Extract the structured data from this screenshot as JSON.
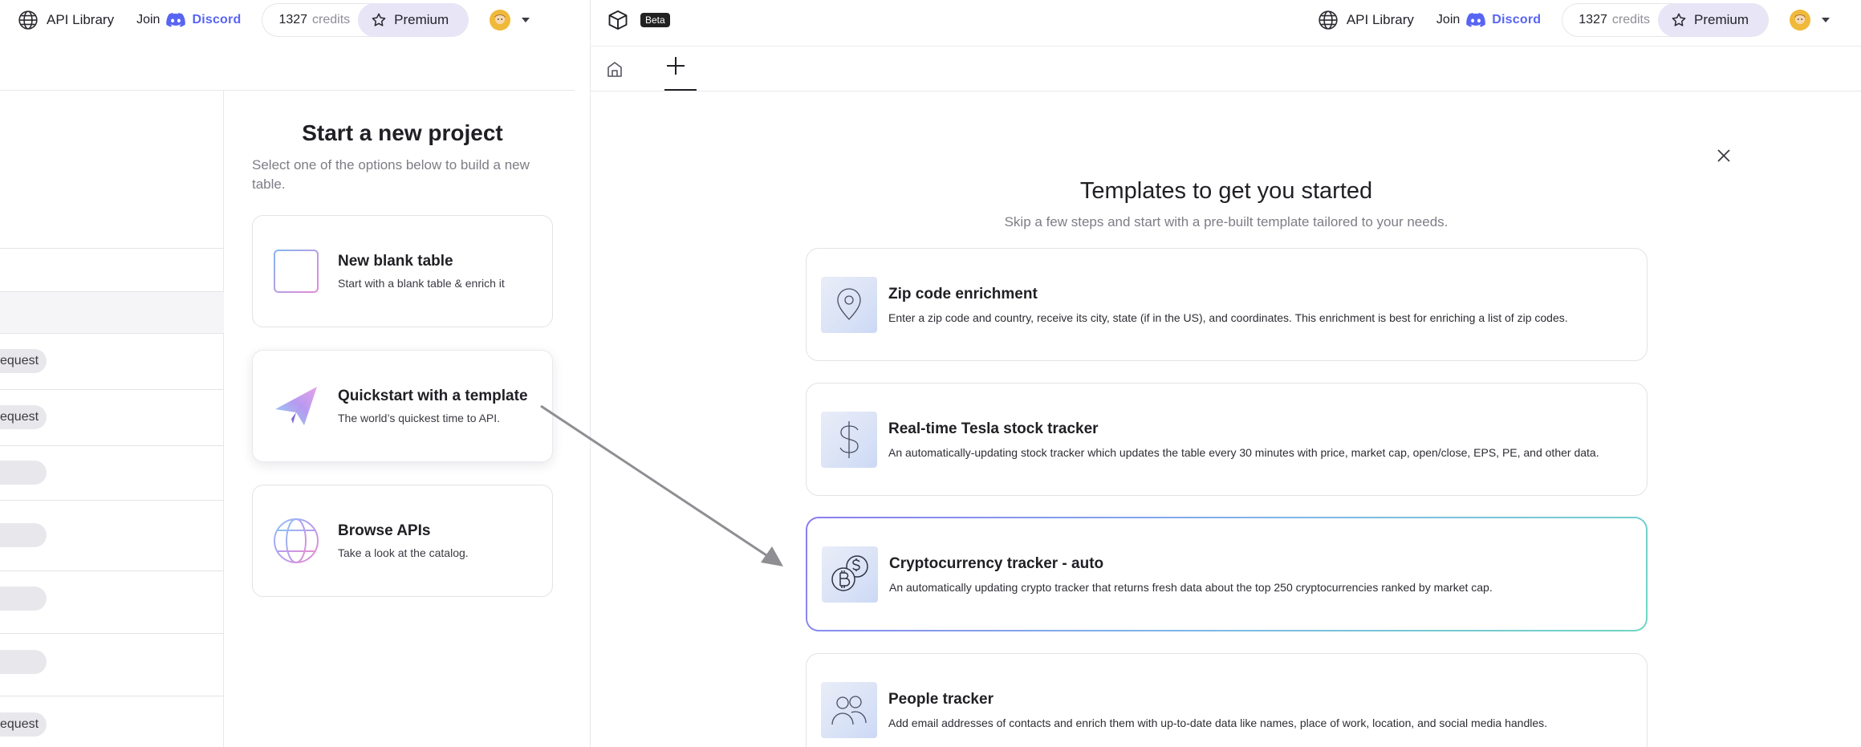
{
  "header": {
    "api_library": "API Library",
    "join": "Join",
    "discord": "Discord",
    "credits_number": "1327",
    "credits_word": "credits",
    "premium": "Premium",
    "beta": "Beta"
  },
  "ghost_table": {
    "chips": [
      "equest",
      "equest",
      "",
      "",
      "",
      "",
      "equest"
    ]
  },
  "new_project": {
    "title": "Start a new project",
    "subtitle": "Select one of the options below to build a new table.",
    "options": [
      {
        "title": "New blank table",
        "desc": "Start with a blank table & enrich it"
      },
      {
        "title": "Quickstart with a template",
        "desc": "The world’s quickest time to API."
      },
      {
        "title": "Browse APIs",
        "desc": "Take a look at the catalog."
      }
    ]
  },
  "templates": {
    "title": "Templates to get you started",
    "subtitle": "Skip a few steps and start with a pre-built template tailored to your needs.",
    "items": [
      {
        "title": "Zip code enrichment",
        "desc": "Enter a zip code and country, receive its city, state (if in the US), and coordinates. This enrichment is best for enriching a list of zip codes.",
        "icon": "map-pin-icon"
      },
      {
        "title": "Real-time Tesla stock tracker",
        "desc": "An automatically-updating stock tracker which updates the table every 30 minutes with price, market cap, open/close, EPS, PE, and other data.",
        "icon": "dollar-icon"
      },
      {
        "title": "Cryptocurrency tracker - auto",
        "desc": "An automatically updating crypto tracker that returns fresh data about the top 250 cryptocurrencies ranked by market cap.",
        "icon": "crypto-coins-icon"
      },
      {
        "title": "People tracker",
        "desc": "Add email addresses of contacts and enrich them with up-to-date data like names, place of work, location, and social media handles.",
        "icon": "people-icon"
      }
    ]
  }
}
